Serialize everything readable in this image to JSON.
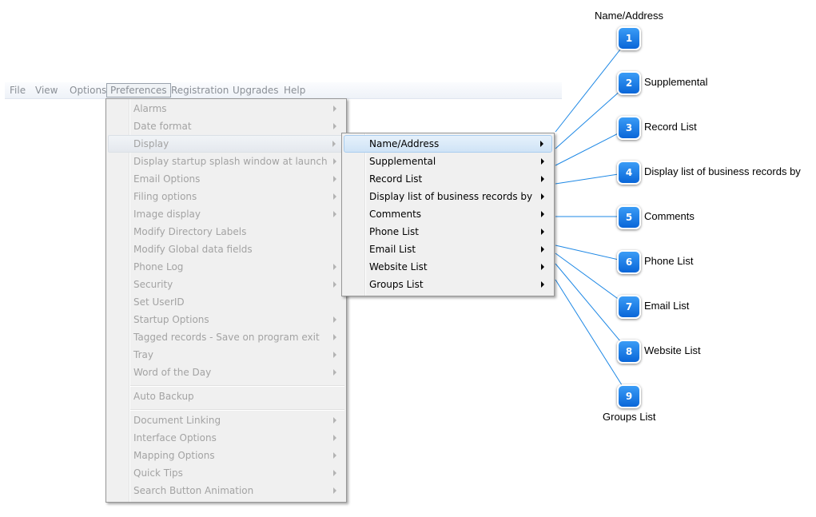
{
  "menubar": {
    "items": [
      "File",
      "View",
      "Options",
      "Preferences",
      "Registration",
      "Upgrades",
      "Help"
    ],
    "active": "Preferences"
  },
  "preferences_menu": {
    "items": [
      {
        "label": "Alarms",
        "submenu": true
      },
      {
        "label": "Date format",
        "submenu": true
      },
      {
        "label": "Display",
        "submenu": true,
        "highlighted": true
      },
      {
        "label": "Display startup splash window at launch",
        "submenu": true
      },
      {
        "label": "Email Options",
        "submenu": true
      },
      {
        "label": "Filing options",
        "submenu": true
      },
      {
        "label": "Image display",
        "submenu": true
      },
      {
        "label": "Modify Directory Labels",
        "submenu": false
      },
      {
        "label": "Modify Global data fields",
        "submenu": false
      },
      {
        "label": "Phone Log",
        "submenu": true
      },
      {
        "label": "Security",
        "submenu": true
      },
      {
        "label": "Set UserID",
        "submenu": false
      },
      {
        "label": "Startup Options",
        "submenu": true
      },
      {
        "label": "Tagged records - Save on program exit",
        "submenu": true
      },
      {
        "label": "Tray",
        "submenu": true
      },
      {
        "label": "Word of the Day",
        "submenu": true
      },
      {
        "label": "Auto Backup",
        "submenu": false
      },
      {
        "label": "Document Linking",
        "submenu": true
      },
      {
        "label": "Interface Options",
        "submenu": true
      },
      {
        "label": "Mapping Options",
        "submenu": true
      },
      {
        "label": "Quick Tips",
        "submenu": true
      },
      {
        "label": "Search Button Animation",
        "submenu": true
      }
    ]
  },
  "display_menu": {
    "items": [
      {
        "label": "Name/Address",
        "highlighted": true
      },
      {
        "label": "Supplemental"
      },
      {
        "label": "Record List"
      },
      {
        "label": "Display list of business records by"
      },
      {
        "label": "Comments"
      },
      {
        "label": "Phone List"
      },
      {
        "label": "Email List"
      },
      {
        "label": "Website List"
      },
      {
        "label": "Groups List"
      }
    ]
  },
  "callouts": [
    {
      "number": "1",
      "label": "Name/Address"
    },
    {
      "number": "2",
      "label": "Supplemental"
    },
    {
      "number": "3",
      "label": "Record List"
    },
    {
      "number": "4",
      "label": "Display list of business records by"
    },
    {
      "number": "5",
      "label": "Comments"
    },
    {
      "number": "6",
      "label": "Phone List"
    },
    {
      "number": "7",
      "label": "Email List"
    },
    {
      "number": "8",
      "label": "Website List"
    },
    {
      "number": "9",
      "label": "Groups List"
    }
  ],
  "colors": {
    "callout_badge": "#0a66d8",
    "connector_line": "#1e88e5",
    "highlight_submenu": "#cfe3f6",
    "disabled_text": "#a3a3a3"
  }
}
